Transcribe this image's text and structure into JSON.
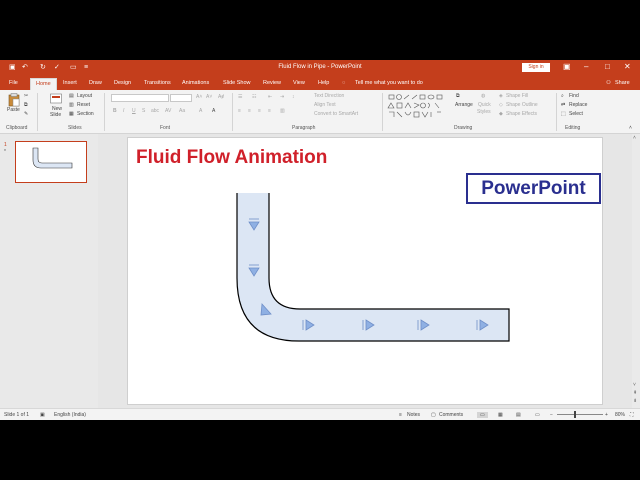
{
  "window": {
    "title": "Fluid Flow in Pipe  -  PowerPoint",
    "sign_in": "Sign in"
  },
  "tabs": [
    {
      "label": "File"
    },
    {
      "label": "Home"
    },
    {
      "label": "Insert"
    },
    {
      "label": "Draw"
    },
    {
      "label": "Design"
    },
    {
      "label": "Transitions"
    },
    {
      "label": "Animations"
    },
    {
      "label": "Slide Show"
    },
    {
      "label": "Review"
    },
    {
      "label": "View"
    },
    {
      "label": "Help"
    }
  ],
  "tell_me": "Tell me what you want to do",
  "share": "Share",
  "ribbon": {
    "clipboard": {
      "paste": "Paste",
      "label": "Clipboard"
    },
    "slides": {
      "new_slide": "New",
      "new_slide2": "Slide",
      "layout": "Layout",
      "reset": "Reset",
      "section": "Section",
      "label": "Slides"
    },
    "font": {
      "label": "Font"
    },
    "paragraph": {
      "text_direction": "Text Direction",
      "align_text": "Align Text",
      "convert_smartart": "Convert to SmartArt",
      "label": "Paragraph"
    },
    "drawing": {
      "arrange": "Arrange",
      "quick_styles": "Quick",
      "quick_styles2": "Styles",
      "shape_fill": "Shape Fill",
      "shape_outline": "Shape Outline",
      "shape_effects": "Shape Effects",
      "label": "Drawing"
    },
    "editing": {
      "find": "Find",
      "replace": "Replace",
      "select": "Select",
      "label": "Editing"
    }
  },
  "thumbnail": {
    "number": "1",
    "star": "*"
  },
  "slide": {
    "title": "Fluid Flow Animation",
    "logo": "PowerPoint"
  },
  "status": {
    "slide_of": "Slide 1 of 1",
    "language": "English (India)",
    "notes": "Notes",
    "comments": "Comments",
    "zoom": "80%"
  },
  "colors": {
    "accent": "#c43e1c",
    "title_red": "#d0202a",
    "logo_blue": "#2a2f8f",
    "pipe_fill": "#dce6f4",
    "arrow_fill": "#8fb0e3"
  }
}
